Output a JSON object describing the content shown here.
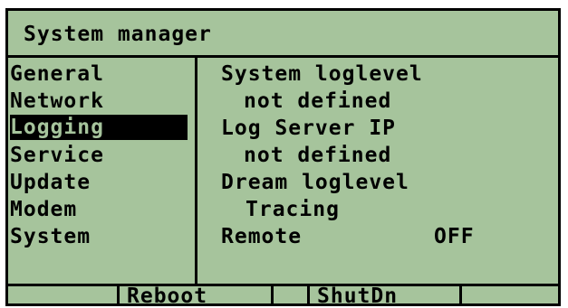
{
  "header": {
    "title": "System manager"
  },
  "menu": {
    "items": [
      {
        "label": "General",
        "selected": false
      },
      {
        "label": "Network",
        "selected": false
      },
      {
        "label": "Logging",
        "selected": true
      },
      {
        "label": "Service",
        "selected": false
      },
      {
        "label": "Update",
        "selected": false
      },
      {
        "label": "Modem",
        "selected": false
      },
      {
        "label": "System",
        "selected": false
      }
    ]
  },
  "logging": {
    "system_loglevel_label": "System loglevel",
    "system_loglevel_value": "not defined",
    "log_server_ip_label": "Log Server IP",
    "log_server_ip_value": "not defined",
    "dream_loglevel_label": "Dream loglevel",
    "dream_loglevel_value": "Tracing",
    "remote_label": "Remote",
    "remote_value": "OFF"
  },
  "function_keys": {
    "f1": "",
    "f2": "Reboot",
    "f3": "",
    "f4": "ShutDn",
    "f5": ""
  },
  "colors": {
    "lcd_background": "#a6c49c",
    "foreground": "#000000"
  }
}
